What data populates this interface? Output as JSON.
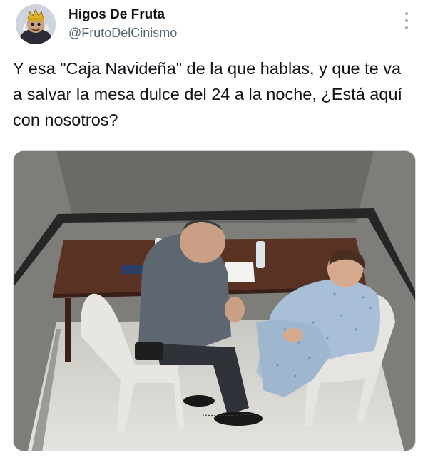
{
  "tweet": {
    "author_name": "Higos De Fruta",
    "author_handle": "@FrutoDelCinismo",
    "text": "Y esa \"Caja Navideña\" de la que hablas, y que te va a salvar la mesa dulce del 24 a la noche, ¿Está aquí con nosotros?",
    "avatar_icon": "king-avatar-icon",
    "menu_icon": "more-options-icon"
  },
  "colors": {
    "name": "#0f1419",
    "handle": "#536471",
    "menu_dots": "#a3abb3",
    "media_border": "#cfd9de"
  }
}
